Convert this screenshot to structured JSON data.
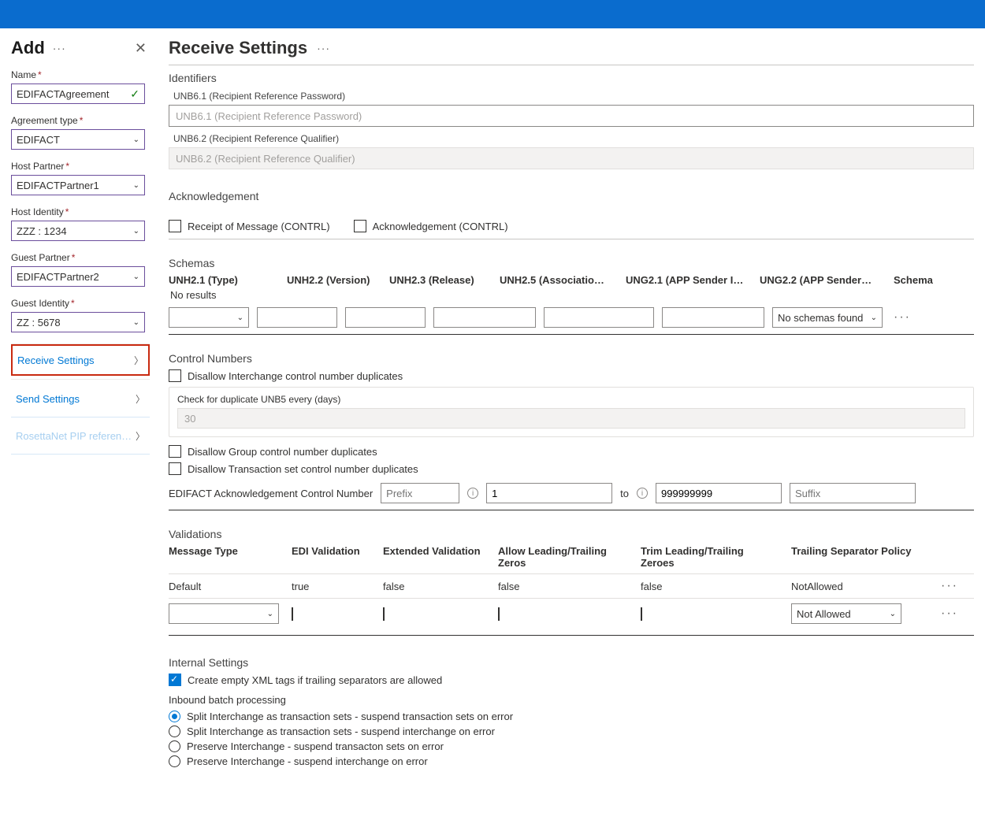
{
  "leftPane": {
    "title": "Add",
    "fields": {
      "name": {
        "label": "Name",
        "value": "EDIFACTAgreement"
      },
      "agreementType": {
        "label": "Agreement type",
        "value": "EDIFACT"
      },
      "hostPartner": {
        "label": "Host Partner",
        "value": "EDIFACTPartner1"
      },
      "hostIdentity": {
        "label": "Host Identity",
        "value": "ZZZ : 1234"
      },
      "guestPartner": {
        "label": "Guest Partner",
        "value": "EDIFACTPartner2"
      },
      "guestIdentity": {
        "label": "Guest Identity",
        "value": "ZZ : 5678"
      }
    },
    "nav": {
      "receive": "Receive Settings",
      "send": "Send Settings",
      "rosetta": "RosettaNet PIP referen…"
    }
  },
  "main": {
    "title": "Receive Settings",
    "identifiers": {
      "title": "Identifiers",
      "unb61": {
        "label": "UNB6.1 (Recipient Reference Password)",
        "ph": "UNB6.1 (Recipient Reference Password)"
      },
      "unb62": {
        "label": "UNB6.2 (Recipient Reference Qualifier)",
        "ph": "UNB6.2 (Recipient Reference Qualifier)"
      }
    },
    "ack": {
      "title": "Acknowledgement",
      "receipt": "Receipt of Message (CONTRL)",
      "contrl": "Acknowledgement (CONTRL)"
    },
    "schemas": {
      "title": "Schemas",
      "cols": [
        "UNH2.1 (Type)",
        "UNH2.2 (Version)",
        "UNH2.3 (Release)",
        "UNH2.5 (Association …",
        "UNG2.1 (APP Sender ID)",
        "UNG2.2 (APP Sender…",
        "Schema"
      ],
      "noResults": "No results",
      "noSchema": "No schemas found"
    },
    "control": {
      "title": "Control Numbers",
      "disallowInterchange": "Disallow Interchange control number duplicates",
      "dupLabel": "Check for duplicate UNB5 every (days)",
      "dupVal": "30",
      "disallowGroup": "Disallow Group control number duplicates",
      "disallowTxn": "Disallow Transaction set control number duplicates",
      "ackLabel": "EDIFACT Acknowledgement Control Number",
      "prefixPh": "Prefix",
      "from": "1",
      "to": "to",
      "toVal": "999999999",
      "suffixPh": "Suffix"
    },
    "validations": {
      "title": "Validations",
      "cols": [
        "Message Type",
        "EDI Validation",
        "Extended Validation",
        "Allow Leading/Trailing Zeros",
        "Trim Leading/Trailing Zeroes",
        "Trailing Separator Policy"
      ],
      "row": [
        "Default",
        "true",
        "false",
        "false",
        "false",
        "NotAllowed"
      ],
      "policy": "Not Allowed"
    },
    "internal": {
      "title": "Internal Settings",
      "emptyXml": "Create empty XML tags if trailing separators are allowed",
      "batchLabel": "Inbound batch processing",
      "opts": [
        "Split Interchange as transaction sets - suspend transaction sets on error",
        "Split Interchange as transaction sets - suspend interchange on error",
        "Preserve Interchange - suspend transacton sets on error",
        "Preserve Interchange - suspend interchange on error"
      ]
    }
  }
}
